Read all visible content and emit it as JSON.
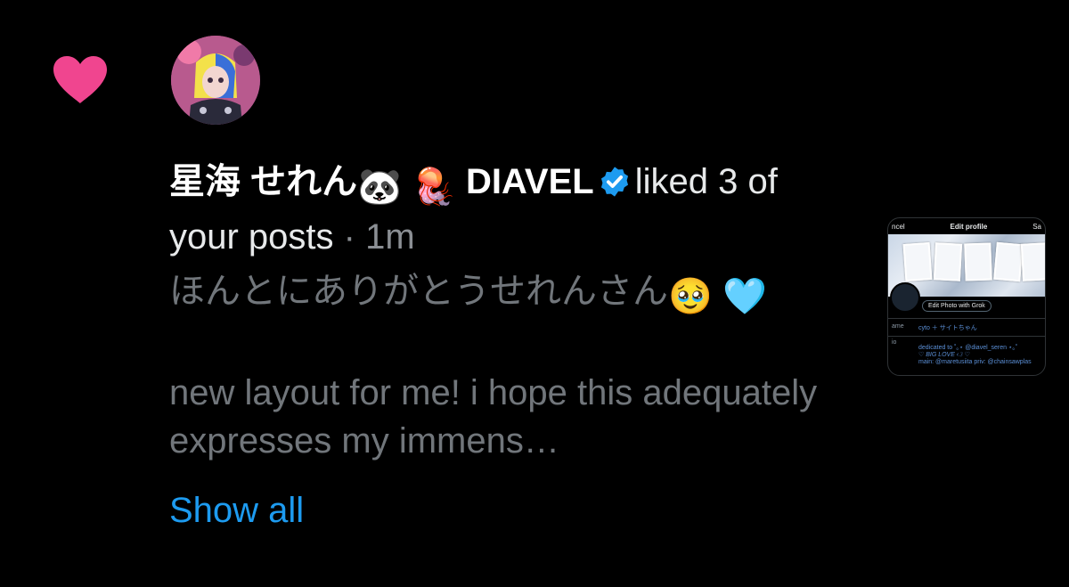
{
  "notification": {
    "type": "like",
    "icons": {
      "heart": "heart-icon",
      "verified": "verified-badge-icon"
    },
    "colors": {
      "heart": "#f91880",
      "verified": "#1d9bf0",
      "link": "#1d9bf0",
      "muted": "#71767b"
    },
    "user": {
      "name_part1": "星海 せれん",
      "emoji1": "🐼",
      "emoji2": "🪼",
      "name_part2": "DIAVEL"
    },
    "action_text": "liked 3 of your posts",
    "separator": "·",
    "timestamp": "1m",
    "post": {
      "line1": "ほんとにありがとうせれんさん",
      "line1_emoji1": "🥹",
      "line1_emoji2": "🩵",
      "line2": "new layout for me! i hope this adequately expresses my immens…"
    },
    "show_all_label": "Show all"
  },
  "thumbnail": {
    "cancel": "ncel",
    "title": "Edit profile",
    "save": "Sa",
    "edit_photo": "Edit Photo with Grok",
    "name_label": "ame",
    "name_value": "cyto ＋ サイトちゃん",
    "bio_label": "io",
    "bio_line1": "dedicated to ˚｡⋆ @diavel_seren ⋆｡˚",
    "bio_line2": "♡ BIG LOVE ‹𝟹 ♡",
    "bio_line3": "main: @maretusiita priv: @chainsawplas"
  }
}
